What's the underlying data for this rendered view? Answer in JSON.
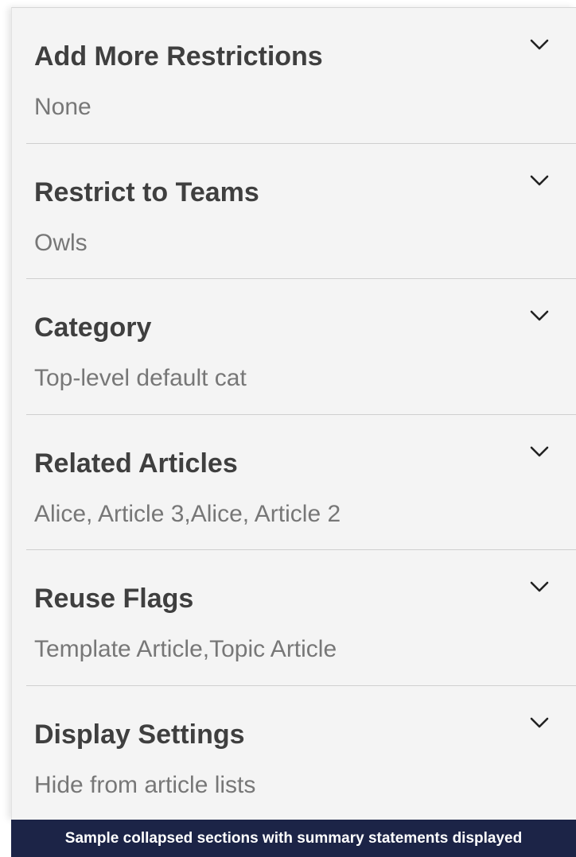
{
  "sections": [
    {
      "title": "Add More Restrictions",
      "summary": "None",
      "icon": "chevron-down-icon"
    },
    {
      "title": "Restrict to Teams",
      "summary": "Owls",
      "icon": "chevron-down-icon"
    },
    {
      "title": "Category",
      "summary": "Top-level default cat",
      "icon": "chevron-down-icon"
    },
    {
      "title": "Related Articles",
      "summary": "Alice, Article 3,Alice, Article 2",
      "icon": "chevron-down-icon"
    },
    {
      "title": "Reuse Flags",
      "summary": "Template Article,Topic Article",
      "icon": "chevron-down-icon"
    },
    {
      "title": "Display Settings",
      "summary": "Hide from article lists",
      "icon": "chevron-down-icon"
    }
  ],
  "caption": "Sample collapsed sections with summary statements displayed",
  "colors": {
    "panel_bg": "#f4f4f4",
    "title_text": "#3f3f3f",
    "summary_text": "#777777",
    "caption_bg": "#1c2447",
    "caption_text": "#ffffff"
  }
}
